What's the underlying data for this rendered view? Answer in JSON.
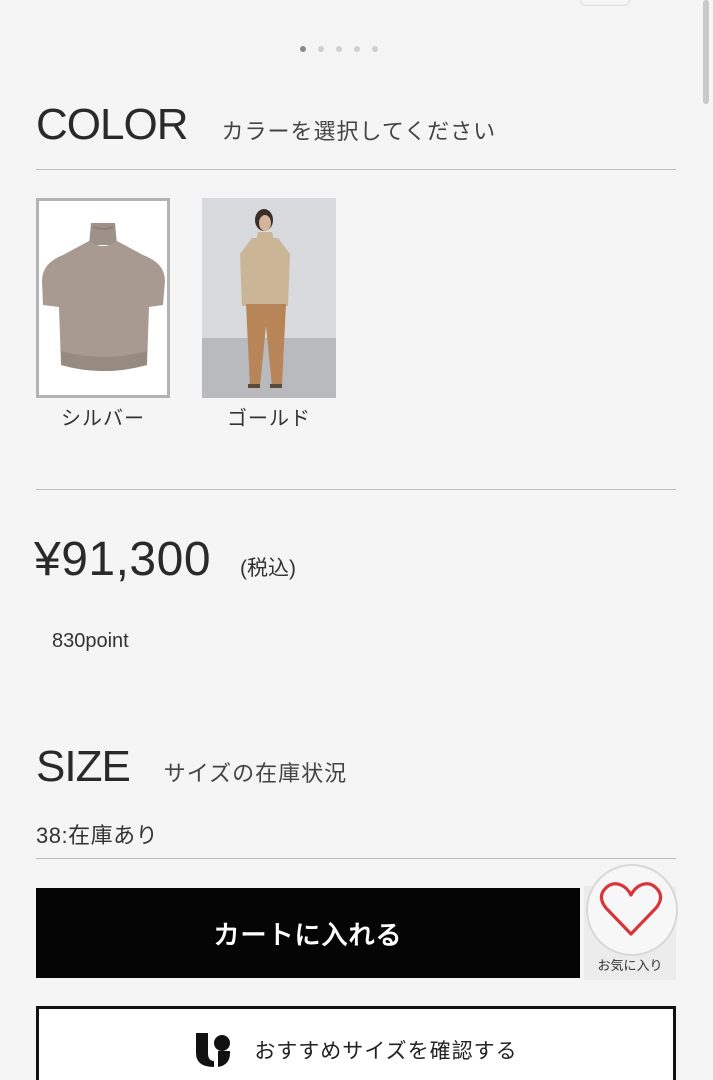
{
  "carousel": {
    "dot_count": 5,
    "active_index": 0
  },
  "color_section": {
    "title": "COLOR",
    "subtitle": "カラーを選択してください",
    "options": [
      {
        "label": "シルバー",
        "selected": true
      },
      {
        "label": "ゴールド",
        "selected": false
      }
    ]
  },
  "price": {
    "amount": "¥91,300",
    "tax_note": "(税込)",
    "points": "830point"
  },
  "size_section": {
    "title": "SIZE",
    "subtitle": "サイズの在庫状況",
    "stock": "38:在庫あり"
  },
  "actions": {
    "add_to_cart": "カートに入れる",
    "favorite": "お気に入り",
    "size_recommend": "おすすめサイズを確認する"
  },
  "colors": {
    "cart_button_bg": "#050505",
    "heart": "#d9343a",
    "divider": "#bdbdbd"
  }
}
